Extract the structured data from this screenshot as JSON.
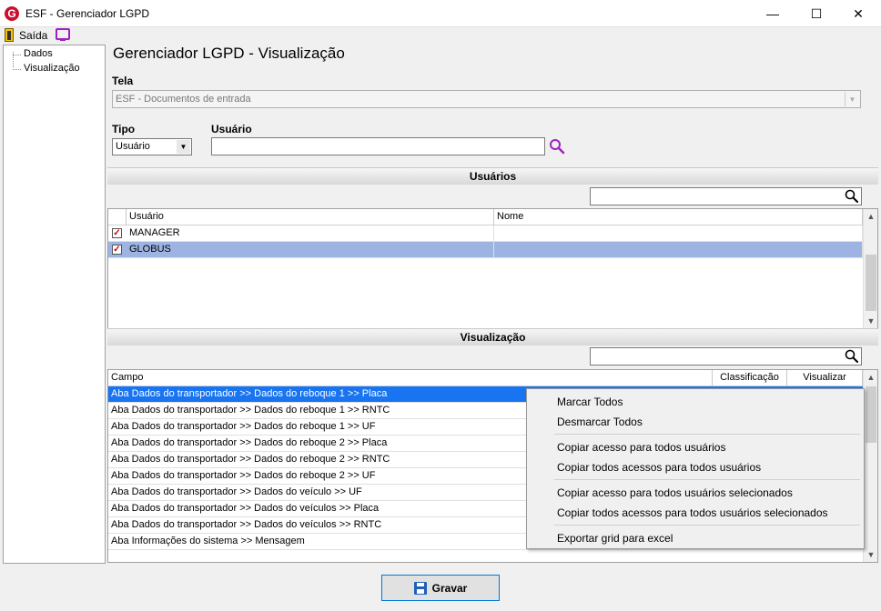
{
  "window": {
    "title": "ESF - Gerenciador LGPD",
    "logo_letter": "G",
    "min_glyph": "—",
    "max_glyph": "☐",
    "close_glyph": "✕"
  },
  "menubar": {
    "exit_label": "Saída",
    "exit_icon": "exit-door-icon",
    "monitor_icon": "monitor-icon"
  },
  "nav": {
    "items": [
      {
        "label": "Dados"
      },
      {
        "label": "Visualização"
      }
    ]
  },
  "page": {
    "title": "Gerenciador LGPD - Visualização"
  },
  "filters": {
    "tela_label": "Tela",
    "tela_value": "ESF - Documentos de entrada",
    "tipo_label": "Tipo",
    "tipo_value": "Usuário",
    "usuario_label": "Usuário",
    "usuario_value": ""
  },
  "usuarios_section": {
    "title": "Usuários",
    "search_value": "",
    "columns": [
      "Usuário",
      "Nome"
    ],
    "rows": [
      {
        "checked": true,
        "usuario": "MANAGER",
        "nome": ""
      },
      {
        "checked": true,
        "usuario": "GLOBUS",
        "nome": ""
      }
    ]
  },
  "visualizacao_section": {
    "title": "Visualização",
    "search_value": "",
    "columns": [
      "Campo",
      "Classificação",
      "Visualizar"
    ],
    "rows": [
      {
        "campo": "Aba Dados do transportador >> Dados do reboque 1 >> Placa"
      },
      {
        "campo": "Aba Dados do transportador >> Dados do reboque 1 >> RNTC"
      },
      {
        "campo": "Aba Dados do transportador >> Dados do reboque 1 >> UF"
      },
      {
        "campo": "Aba Dados do transportador >> Dados do reboque 2 >> Placa"
      },
      {
        "campo": "Aba Dados do transportador >> Dados do reboque 2 >> RNTC"
      },
      {
        "campo": "Aba Dados do transportador >> Dados do reboque 2 >> UF"
      },
      {
        "campo": "Aba Dados do transportador >> Dados do veículo >> UF"
      },
      {
        "campo": "Aba Dados do transportador >> Dados do veículos >> Placa"
      },
      {
        "campo": "Aba Dados do transportador >> Dados do veículos >> RNTC"
      },
      {
        "campo": "Aba Informações do sistema >> Mensagem"
      }
    ]
  },
  "context_menu": {
    "items": [
      "Marcar Todos",
      "Desmarcar Todos",
      "Copiar acesso para todos usuários",
      "Copiar todos acessos para todos usuários",
      "Copiar acesso para todos usuários selecionados",
      "Copiar todos acessos para todos usuários selecionados",
      "Exportar grid para excel"
    ]
  },
  "footer": {
    "save_label": "Gravar"
  },
  "colors": {
    "selection": "#9db4e2",
    "highlight": "#1874f0",
    "accent": "#a020c0"
  }
}
